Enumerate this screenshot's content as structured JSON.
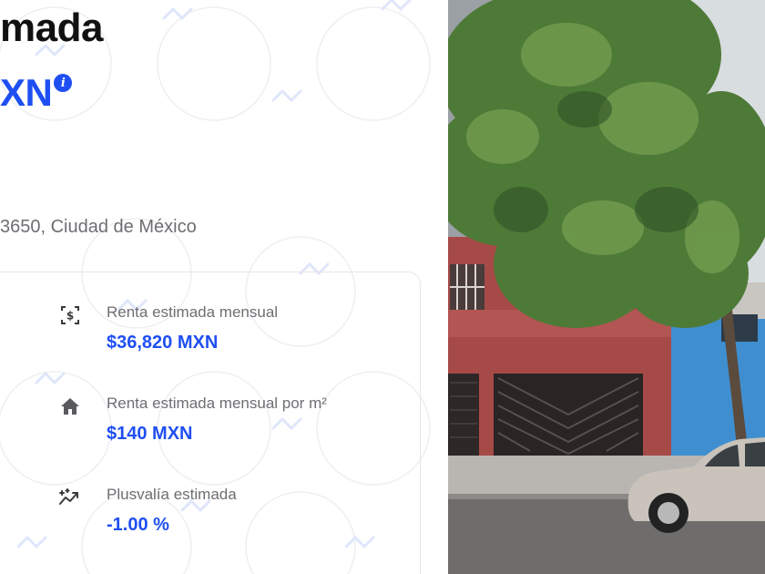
{
  "listing": {
    "title": "mada",
    "price": "XN",
    "info_icon": "info-icon",
    "address": "3650, Ciudad de México"
  },
  "stats": [
    {
      "icon": "rent-money-icon",
      "label": "Renta estimada mensual",
      "value": "$36,820 MXN"
    },
    {
      "icon": "house-icon",
      "label": "Renta estimada mensual por m²",
      "value": "$140 MXN"
    },
    {
      "icon": "trend-up-icon",
      "label": "Plusvalía estimada",
      "value": "-1.00 %"
    }
  ],
  "colors": {
    "accent": "#1f4ff2",
    "text_dark": "#111111",
    "text_muted": "#6e6e73",
    "card_border": "#e6e6ea"
  },
  "photo": {
    "subject": "street-view-photo"
  }
}
